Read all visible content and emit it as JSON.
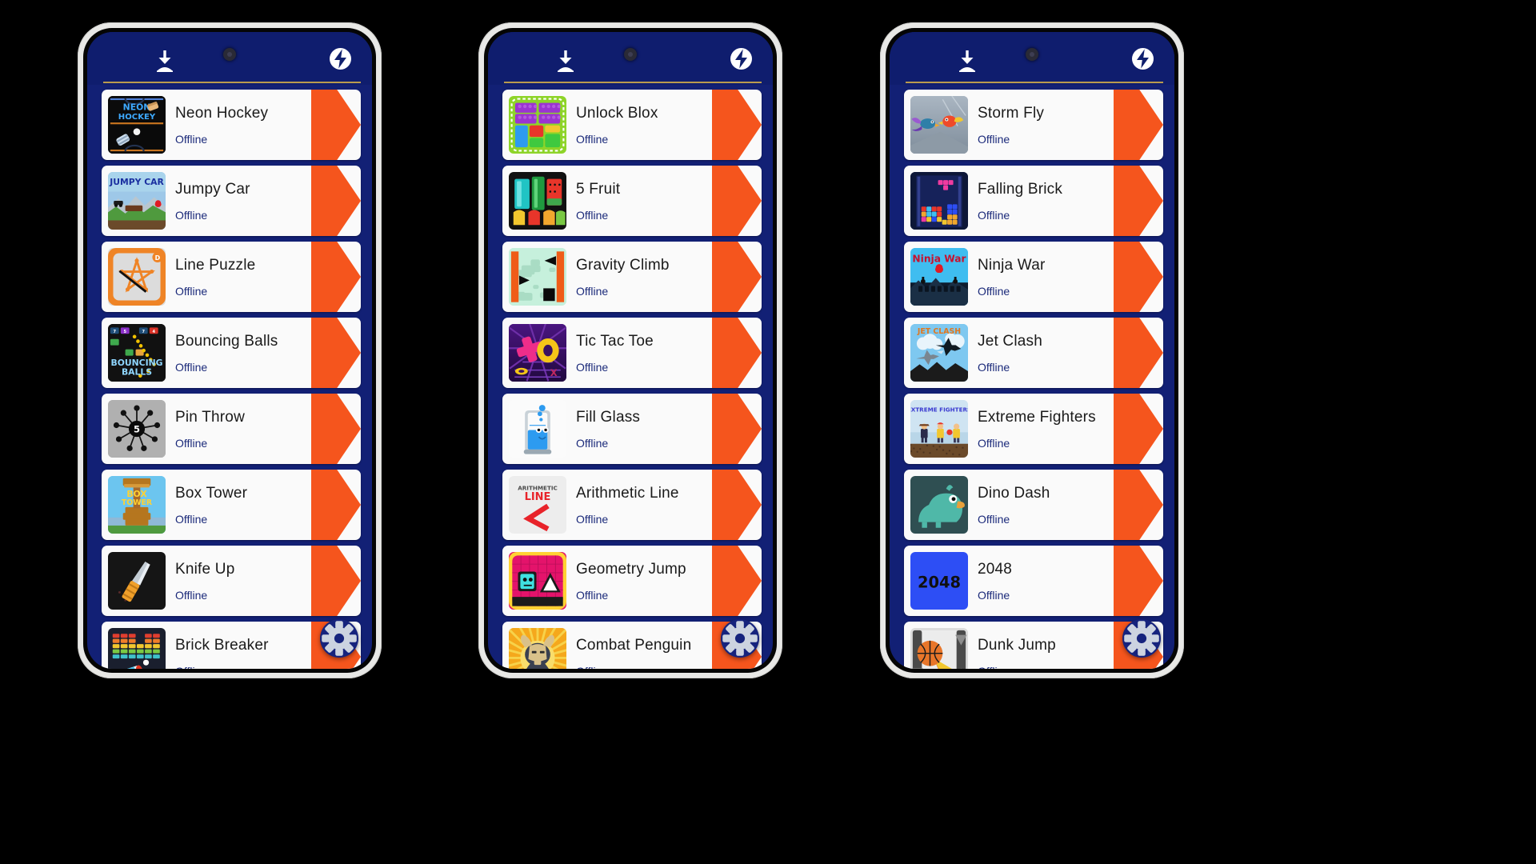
{
  "app": {
    "background_color": "#000000",
    "screen_bg": "#122075",
    "header_bg": "#0f1d6e",
    "accent_orange": "#f5551d",
    "card_bg": "#fafafa",
    "subtitle_color": "#1b2a7a",
    "rule_color": "#b99a4e",
    "fab_color": "#16237d",
    "status_text": "Offline"
  },
  "header": {
    "download_icon": "download-icon",
    "camera_icon": "camera-punch-hole",
    "bolt_icon": "lightning-bolt-icon"
  },
  "fab": {
    "icon": "gear-icon",
    "label": "Settings"
  },
  "phones": [
    {
      "id": "phone-1",
      "games": [
        {
          "title": "Neon Hockey",
          "status": "Offline",
          "icon": "neon-hockey-icon"
        },
        {
          "title": "Jumpy Car",
          "status": "Offline",
          "icon": "jumpy-car-icon"
        },
        {
          "title": "Line Puzzle",
          "status": "Offline",
          "icon": "line-puzzle-icon"
        },
        {
          "title": "Bouncing Balls",
          "status": "Offline",
          "icon": "bouncing-balls-icon"
        },
        {
          "title": "Pin Throw",
          "status": "Offline",
          "icon": "pin-throw-icon"
        },
        {
          "title": "Box Tower",
          "status": "Offline",
          "icon": "box-tower-icon"
        },
        {
          "title": "Knife Up",
          "status": "Offline",
          "icon": "knife-up-icon"
        },
        {
          "title": "Brick Breaker",
          "status": "Offline",
          "icon": "brick-breaker-icon"
        }
      ]
    },
    {
      "id": "phone-2",
      "games": [
        {
          "title": "Unlock Blox",
          "status": "Offline",
          "icon": "unlock-blox-icon"
        },
        {
          "title": "5 Fruit",
          "status": "Offline",
          "icon": "five-fruit-icon"
        },
        {
          "title": "Gravity Climb",
          "status": "Offline",
          "icon": "gravity-climb-icon"
        },
        {
          "title": "Tic Tac Toe",
          "status": "Offline",
          "icon": "tic-tac-toe-icon"
        },
        {
          "title": "Fill Glass",
          "status": "Offline",
          "icon": "fill-glass-icon"
        },
        {
          "title": "Arithmetic Line",
          "status": "Offline",
          "icon": "arithmetic-line-icon"
        },
        {
          "title": "Geometry Jump",
          "status": "Offline",
          "icon": "geometry-jump-icon"
        },
        {
          "title": "Combat Penguin",
          "status": "Offline",
          "icon": "combat-penguin-icon"
        }
      ]
    },
    {
      "id": "phone-3",
      "games": [
        {
          "title": "Storm Fly",
          "status": "Offline",
          "icon": "storm-fly-icon"
        },
        {
          "title": "Falling Brick",
          "status": "Offline",
          "icon": "falling-brick-icon"
        },
        {
          "title": "Ninja War",
          "status": "Offline",
          "icon": "ninja-war-icon"
        },
        {
          "title": "Jet Clash",
          "status": "Offline",
          "icon": "jet-clash-icon"
        },
        {
          "title": "Extreme Fighters",
          "status": "Offline",
          "icon": "extreme-fighters-icon"
        },
        {
          "title": "Dino Dash",
          "status": "Offline",
          "icon": "dino-dash-icon"
        },
        {
          "title": "2048",
          "status": "Offline",
          "icon": "game-2048-icon"
        },
        {
          "title": "Dunk Jump",
          "status": "Offline",
          "icon": "dunk-jump-icon"
        }
      ]
    }
  ],
  "icon_art": {
    "neon-hockey-icon": {
      "text": "NEON HOCKEY",
      "bg": "#0a0a0a",
      "fg": "#3da9ff"
    },
    "jumpy-car-icon": {
      "text": "JUMPY CAR",
      "bg": "#9ec8e8",
      "fg": "#1a2fa0"
    },
    "line-puzzle-icon": {
      "text": "",
      "bg": "#dcdcdc",
      "fg": "#ef8426"
    },
    "bouncing-balls-icon": {
      "text": "BOUNCING BALLS",
      "bg": "#111111",
      "fg": "#8fd6ff"
    },
    "pin-throw-icon": {
      "text": "5",
      "bg": "#b0b0b0",
      "fg": "#000000"
    },
    "box-tower-icon": {
      "text": "BOX TOWER",
      "bg": "#6cc5ef",
      "fg": "#ffd233"
    },
    "knife-up-icon": {
      "text": "",
      "bg": "#151515",
      "fg": "#f0a02a"
    },
    "brick-breaker-icon": {
      "text": "",
      "bg": "#1a1f2e",
      "fg": "#49c6f0"
    },
    "unlock-blox-icon": {
      "text": "",
      "bg": "#8ed429",
      "fg": "#9b34d1"
    },
    "five-fruit-icon": {
      "text": "",
      "bg": "#111111",
      "fg": "#20c4c4"
    },
    "gravity-climb-icon": {
      "text": "",
      "bg": "#c6f0dc",
      "fg": "#ef5c18"
    },
    "tic-tac-toe-icon": {
      "text": "",
      "bg": "#3b1160",
      "fg": "#f5c518"
    },
    "fill-glass-icon": {
      "text": "",
      "bg": "#fbfbfb",
      "fg": "#2d9bf0"
    },
    "arithmetic-line-icon": {
      "text": "ARITHMETIC LINE",
      "bg": "#ededed",
      "fg": "#e8232a"
    },
    "geometry-jump-icon": {
      "text": "",
      "bg": "#e4136b",
      "fg": "#ffd233"
    },
    "combat-penguin-icon": {
      "text": "",
      "bg": "#f5a81c",
      "fg": "#d9c18a"
    },
    "storm-fly-icon": {
      "text": "",
      "bg": "#9aa7b4",
      "fg": "#ef4a2a"
    },
    "falling-brick-icon": {
      "text": "",
      "bg": "#0d1738",
      "fg": "#ef3ba0"
    },
    "ninja-war-icon": {
      "text": "Ninja War",
      "bg": "#3fbdf0",
      "fg": "#c8102e"
    },
    "jet-clash-icon": {
      "text": "JET CLASH",
      "bg": "#7ec8f0",
      "fg": "#e07820"
    },
    "extreme-fighters-icon": {
      "text": "EXTREME FIGHTERS",
      "bg": "#cfe4f2",
      "fg": "#3a3ad0"
    },
    "dino-dash-icon": {
      "text": "",
      "bg": "#2f4f52",
      "fg": "#4fb8a8"
    },
    "game-2048-icon": {
      "text": "2048",
      "bg": "#2d4ef5",
      "fg": "#101010"
    },
    "dunk-jump-icon": {
      "text": "",
      "bg": "#dcdcdc",
      "fg": "#e87722"
    }
  }
}
